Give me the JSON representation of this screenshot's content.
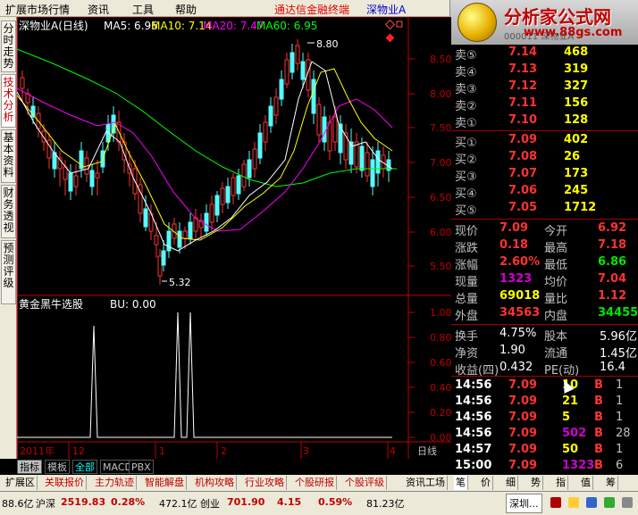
{
  "menu": {
    "items": [
      "扩展市场行情",
      "资讯",
      "工具",
      "帮助"
    ],
    "brand": "通达信金融终端",
    "stock_tag": "深物业A"
  },
  "logo": {
    "title": "分析家公式网",
    "url": "www.88gs.com",
    "ghost": "000011 深物业A"
  },
  "left_tabs": [
    {
      "label": "分时走势",
      "active": false
    },
    {
      "label": "技术分析",
      "active": true
    },
    {
      "label": "基本资料",
      "active": false
    },
    {
      "label": "财务透视",
      "active": false
    },
    {
      "label": "预测评级",
      "active": false
    }
  ],
  "main_chart": {
    "title": "深物业A(日线)",
    "ma5_label": "MA5: 6.96",
    "ma10_label": "MA10: 7.14",
    "ma20_label": "MA20: 7.47",
    "ma60_label": "MA60: 6.95",
    "high_marker": "8.80",
    "low_marker": "5.32",
    "y_ticks": [
      "8.50",
      "8.00",
      "7.50",
      "7.00",
      "6.50",
      "6.00",
      "5.50"
    ],
    "colors": {
      "ma5": "#ffffff",
      "ma10": "#ffff00",
      "ma20": "#ff00ff",
      "ma60": "#00ff00",
      "up": "#ff3232",
      "down": "#54fcfc",
      "axis": "#c00000"
    }
  },
  "indicator": {
    "title": "黄金黑牛选股",
    "value_label": "BU: 0.00",
    "y_ticks": [
      "1.00",
      "0.80",
      "0.60",
      "0.40",
      "0.20",
      "0.00"
    ]
  },
  "time_axis": {
    "labels": [
      "2011年",
      "12",
      "1",
      "2",
      "3",
      "4"
    ],
    "period": "日线"
  },
  "order_book": {
    "sell": [
      {
        "label": "卖⑤",
        "price": "7.14",
        "vol": "468"
      },
      {
        "label": "卖④",
        "price": "7.13",
        "vol": "319"
      },
      {
        "label": "卖③",
        "price": "7.12",
        "vol": "327"
      },
      {
        "label": "卖②",
        "price": "7.11",
        "vol": "156"
      },
      {
        "label": "卖①",
        "price": "7.10",
        "vol": "128"
      }
    ],
    "buy": [
      {
        "label": "买①",
        "price": "7.09",
        "vol": "402"
      },
      {
        "label": "买②",
        "price": "7.08",
        "vol": "26"
      },
      {
        "label": "买③",
        "price": "7.07",
        "vol": "173"
      },
      {
        "label": "买④",
        "price": "7.06",
        "vol": "245"
      },
      {
        "label": "买⑤",
        "price": "7.05",
        "vol": "1712"
      }
    ]
  },
  "stats": [
    {
      "l1": "现价",
      "v1": "7.09",
      "c1": "#ff3232",
      "l2": "今开",
      "v2": "6.92",
      "c2": "#ff3232"
    },
    {
      "l1": "涨跌",
      "v1": "0.18",
      "c1": "#ff3232",
      "l2": "最高",
      "v2": "7.18",
      "c2": "#ff3232"
    },
    {
      "l1": "涨幅",
      "v1": "2.60%",
      "c1": "#ff3232",
      "l2": "最低",
      "v2": "6.86",
      "c2": "#00e600"
    },
    {
      "l1": "现量",
      "v1": "1323",
      "c1": "#d000d0",
      "l2": "均价",
      "v2": "7.04",
      "c2": "#ff3232"
    },
    {
      "l1": "总量",
      "v1": "69018",
      "c1": "#ffff00",
      "l2": "量比",
      "v2": "1.12",
      "c2": "#ff3232"
    },
    {
      "l1": "外盘",
      "v1": "34563",
      "c1": "#ff3232",
      "l2": "内盘",
      "v2": "34455",
      "c2": "#00e600"
    }
  ],
  "stats2": [
    {
      "l1": "换手",
      "v1": "4.75%",
      "l2": "股本",
      "v2": "5.96亿"
    },
    {
      "l1": "净资",
      "v1": "1.90",
      "l2": "流通",
      "v2": "1.45亿"
    },
    {
      "l1": "收益(四)",
      "v1": "0.432",
      "l2": "PE(动)",
      "v2": "16.4"
    }
  ],
  "ticks": [
    {
      "time": "14:56",
      "price": "7.09",
      "vol": "10",
      "flag": "B",
      "n": "1",
      "vc": "#ffff00"
    },
    {
      "time": "14:56",
      "price": "7.09",
      "vol": "21",
      "flag": "B",
      "n": "1",
      "vc": "#ffff00"
    },
    {
      "time": "14:56",
      "price": "7.09",
      "vol": "5",
      "flag": "B",
      "n": "1",
      "vc": "#ffff00"
    },
    {
      "time": "14:56",
      "price": "7.09",
      "vol": "502",
      "flag": "B",
      "n": "28",
      "vc": "#d000d0"
    },
    {
      "time": "14:57",
      "price": "7.09",
      "vol": "50",
      "flag": "B",
      "n": "1",
      "vc": "#ffff00"
    },
    {
      "time": "15:00",
      "price": "7.09",
      "vol": "1323",
      "flag": "B",
      "n": "6",
      "vc": "#d000d0"
    }
  ],
  "bottom_tabs": [
    "指标",
    "模板",
    "全部",
    "MACD",
    "PBX"
  ],
  "func_tabs": [
    "扩展区",
    "关联报价",
    "主力轨迹",
    "智能解盘",
    "机构攻略",
    "行业攻略",
    "个股研报",
    "个股评级",
    "资讯工场"
  ],
  "right_tabs": [
    "笔",
    "价",
    "细",
    "势",
    "指",
    "值",
    "筹"
  ],
  "status": {
    "v0": "88.6亿",
    "l1": "沪深",
    "v1": "2519.83",
    "v2": "0.28%",
    "v3": "472.1亿",
    "l4": "创业",
    "v4": "701.90",
    "v5": "4.15",
    "v6": "0.59%",
    "v7": "81.23亿",
    "l8": "深圳..."
  }
}
